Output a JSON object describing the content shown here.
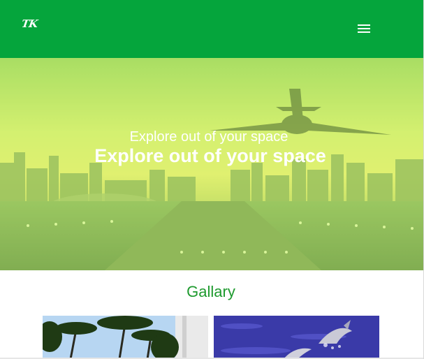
{
  "header": {
    "logo_text": "TK",
    "menu_icon": "hamburger-menu-icon",
    "background_color": "#05a53c"
  },
  "hero": {
    "subtitle": "Explore out of your space",
    "title": "Explore out of your space",
    "overlay_color": "#c8f06e"
  },
  "gallery": {
    "title": "Gallary",
    "title_color": "#1e9a2e",
    "images": [
      {
        "name": "palm-trees-image"
      },
      {
        "name": "dolphins-image"
      }
    ]
  }
}
